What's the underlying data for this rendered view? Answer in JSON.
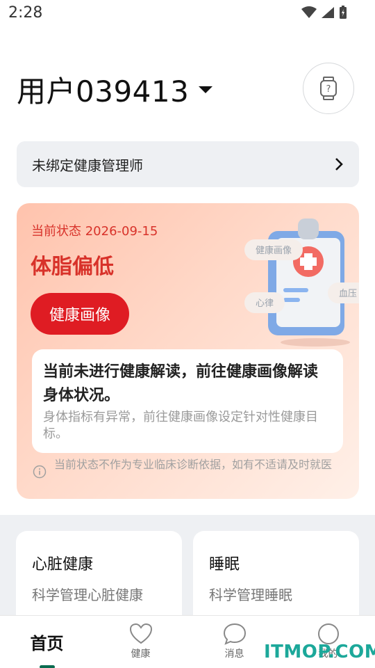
{
  "status_bar": {
    "time": "2:28"
  },
  "header": {
    "username": "用户039413"
  },
  "bind_bar": {
    "label": "未绑定健康管理师"
  },
  "status_card": {
    "date": "当前状态 2026-09-15",
    "title": "体脂偏低",
    "button_label": "健康画像",
    "illustration_tags": [
      "健康画像",
      "心律",
      "血压"
    ],
    "interpretation": {
      "main": "当前未进行健康解读，前往健康画像解读身体状况。",
      "sub": "身体指标有异常，前往健康画像设定针对性健康目标。"
    },
    "disclaimer": "当前状态不作为专业临床诊断依据，如有不适请及时就医"
  },
  "features": [
    {
      "title": "心脏健康",
      "subtitle": "科学管理心脏健康"
    },
    {
      "title": "睡眠",
      "subtitle": "科学管理睡眠"
    }
  ],
  "tabs": [
    {
      "label": "首页",
      "icon": "home-icon",
      "active": true
    },
    {
      "label": "健康",
      "icon": "heart-icon",
      "active": false
    },
    {
      "label": "消息",
      "icon": "chat-icon",
      "active": false
    },
    {
      "label": "我的",
      "icon": "profile-icon",
      "active": false
    }
  ],
  "watermark": "ITMOP.COM",
  "colors": {
    "accent_red": "#df1c23",
    "brand_green": "#0a6b50",
    "watermark": "#1ca89a"
  }
}
